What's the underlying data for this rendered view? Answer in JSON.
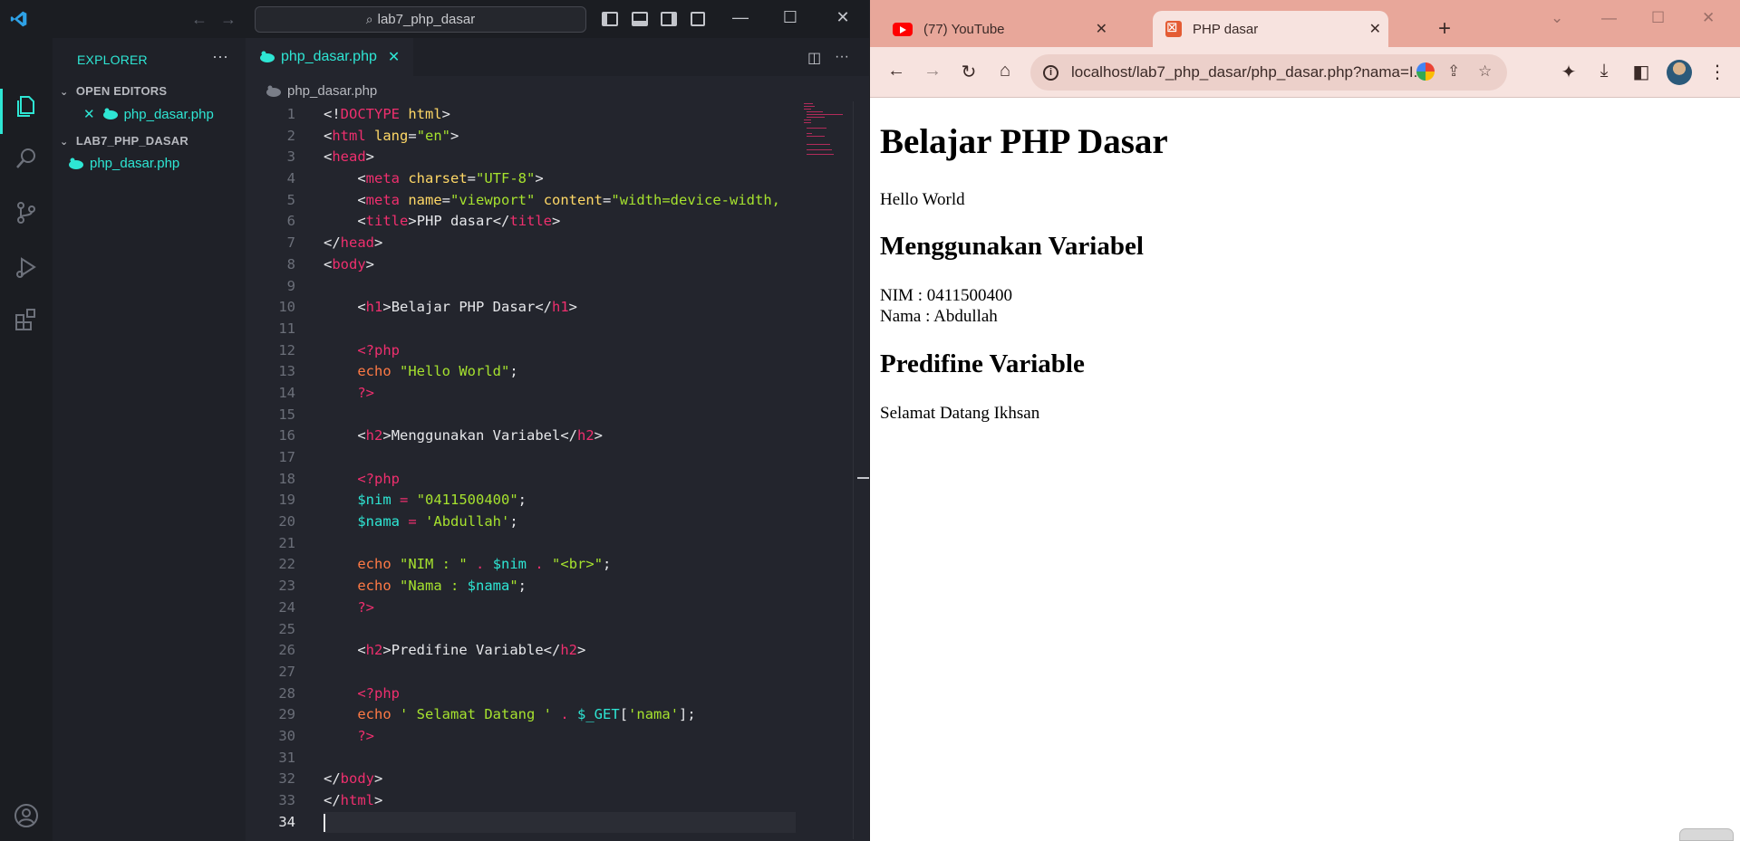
{
  "vscode": {
    "command_center": "lab7_php_dasar",
    "explorer_title": "EXPLORER",
    "open_editors_label": "OPEN EDITORS",
    "project_label": "LAB7_PHP_DASAR",
    "open_file": "php_dasar.php",
    "tree_file": "php_dasar.php",
    "tab_label": "php_dasar.php",
    "breadcrumb_file": "php_dasar.php",
    "current_line": 34,
    "accent_color": "#2ee6d4"
  },
  "code_lines": [
    {
      "n": "1",
      "html": "<span class=\"p\">&lt;!</span><span class=\"t\">DOCTYPE</span> <span class=\"a\">html</span><span class=\"p\">&gt;</span>"
    },
    {
      "n": "2",
      "html": "<span class=\"p\">&lt;</span><span class=\"t\">html</span> <span class=\"a\">lang</span><span class=\"p\">=</span><span class=\"s\">\"en\"</span><span class=\"p\">&gt;</span>"
    },
    {
      "n": "3",
      "html": "<span class=\"p\">&lt;</span><span class=\"t\">head</span><span class=\"p\">&gt;</span>"
    },
    {
      "n": "4",
      "html": "    <span class=\"p\">&lt;</span><span class=\"t\">meta</span> <span class=\"a\">charset</span><span class=\"p\">=</span><span class=\"s\">\"UTF-8\"</span><span class=\"p\">&gt;</span>"
    },
    {
      "n": "5",
      "html": "    <span class=\"p\">&lt;</span><span class=\"t\">meta</span> <span class=\"a\">name</span><span class=\"p\">=</span><span class=\"s\">\"viewport\"</span> <span class=\"a\">content</span><span class=\"p\">=</span><span class=\"s\">\"width=device-width,</span>"
    },
    {
      "n": "6",
      "html": "    <span class=\"p\">&lt;</span><span class=\"t\">title</span><span class=\"p\">&gt;</span>PHP dasar<span class=\"p\">&lt;/</span><span class=\"t\">title</span><span class=\"p\">&gt;</span>"
    },
    {
      "n": "7",
      "html": "<span class=\"p\">&lt;/</span><span class=\"t\">head</span><span class=\"p\">&gt;</span>"
    },
    {
      "n": "8",
      "html": "<span class=\"p\">&lt;</span><span class=\"t\">body</span><span class=\"p\">&gt;</span>"
    },
    {
      "n": "9",
      "html": ""
    },
    {
      "n": "10",
      "html": "    <span class=\"p\">&lt;</span><span class=\"t\">h1</span><span class=\"p\">&gt;</span>Belajar PHP Dasar<span class=\"p\">&lt;/</span><span class=\"t\">h1</span><span class=\"p\">&gt;</span>"
    },
    {
      "n": "11",
      "html": ""
    },
    {
      "n": "12",
      "html": "    <span class=\"t\">&lt;?php</span>"
    },
    {
      "n": "13",
      "html": "    <span class=\"k\">echo</span> <span class=\"s\">\"Hello World\"</span><span class=\"p\">;</span>"
    },
    {
      "n": "14",
      "html": "    <span class=\"t\">?&gt;</span>"
    },
    {
      "n": "15",
      "html": ""
    },
    {
      "n": "16",
      "html": "    <span class=\"p\">&lt;</span><span class=\"t\">h2</span><span class=\"p\">&gt;</span>Menggunakan Variabel<span class=\"p\">&lt;/</span><span class=\"t\">h2</span><span class=\"p\">&gt;</span>"
    },
    {
      "n": "17",
      "html": ""
    },
    {
      "n": "18",
      "html": "    <span class=\"t\">&lt;?php</span>"
    },
    {
      "n": "19",
      "html": "    <span class=\"v\">$nim</span> <span class=\"o\">=</span> <span class=\"s\">\"0411500400\"</span><span class=\"p\">;</span>"
    },
    {
      "n": "20",
      "html": "    <span class=\"v\">$nama</span> <span class=\"o\">=</span> <span class=\"s\">'Abdullah'</span><span class=\"p\">;</span>"
    },
    {
      "n": "21",
      "html": ""
    },
    {
      "n": "22",
      "html": "    <span class=\"k\">echo</span> <span class=\"s\">\"NIM : \"</span> <span class=\"o\">.</span> <span class=\"v\">$nim</span> <span class=\"o\">.</span> <span class=\"s\">\"&lt;br&gt;\"</span><span class=\"p\">;</span>"
    },
    {
      "n": "23",
      "html": "    <span class=\"k\">echo</span> <span class=\"s\">\"Nama : </span><span class=\"v\">$nama</span><span class=\"s\">\"</span><span class=\"p\">;</span>"
    },
    {
      "n": "24",
      "html": "    <span class=\"t\">?&gt;</span>"
    },
    {
      "n": "25",
      "html": ""
    },
    {
      "n": "26",
      "html": "    <span class=\"p\">&lt;</span><span class=\"t\">h2</span><span class=\"p\">&gt;</span>Predifine Variable<span class=\"p\">&lt;/</span><span class=\"t\">h2</span><span class=\"p\">&gt;</span>"
    },
    {
      "n": "27",
      "html": ""
    },
    {
      "n": "28",
      "html": "    <span class=\"t\">&lt;?php</span>"
    },
    {
      "n": "29",
      "html": "    <span class=\"k\">echo</span> <span class=\"s\">' Selamat Datang '</span> <span class=\"o\">.</span> <span class=\"v\">$_GET</span><span class=\"p\">[</span><span class=\"s\">'nama'</span><span class=\"p\">];</span>"
    },
    {
      "n": "30",
      "html": "    <span class=\"t\">?&gt;</span>"
    },
    {
      "n": "31",
      "html": ""
    },
    {
      "n": "32",
      "html": "<span class=\"p\">&lt;/</span><span class=\"t\">body</span><span class=\"p\">&gt;</span>"
    },
    {
      "n": "33",
      "html": "<span class=\"p\">&lt;/</span><span class=\"t\">html</span><span class=\"p\">&gt;</span>"
    },
    {
      "n": "34",
      "html": ""
    }
  ],
  "chrome": {
    "tabs": [
      {
        "label": "(77) YouTube",
        "icon": "youtube-icon"
      },
      {
        "label": "PHP dasar",
        "icon": "xml-file-icon"
      }
    ],
    "url": "localhost/lab7_php_dasar/php_dasar.php?nama=I...",
    "tab_strip_color": "#e8a79a",
    "toolbar_color": "#f7e3df"
  },
  "page": {
    "h1": "Belajar PHP Dasar",
    "hello": "Hello World",
    "h2_variables": "Menggunakan Variabel",
    "nim_line": "NIM : 0411500400",
    "nama_line": "Nama : Abdullah",
    "h2_predefine": "Predifine Variable",
    "welcome": "Selamat Datang Ikhsan"
  }
}
